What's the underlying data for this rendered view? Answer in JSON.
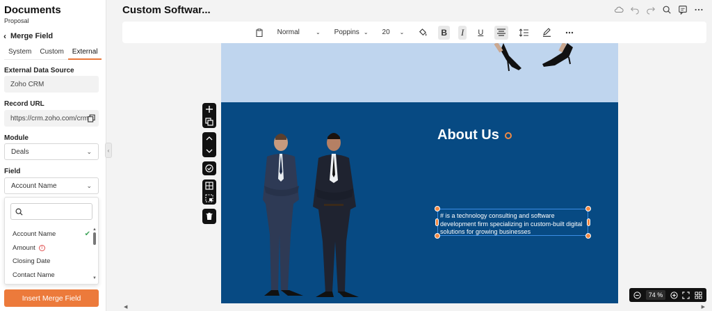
{
  "sidebar": {
    "title": "Documents",
    "subtitle": "Proposal",
    "back_label": "Merge Field",
    "tabs": [
      {
        "label": "System"
      },
      {
        "label": "Custom"
      },
      {
        "label": "External"
      }
    ],
    "external_source": {
      "label": "External Data Source",
      "value": "Zoho CRM"
    },
    "record_url": {
      "label": "Record URL",
      "value": "https://crm.zoho.com/crm/"
    },
    "module": {
      "label": "Module",
      "value": "Deals"
    },
    "field": {
      "label": "Field",
      "value": "Account Name"
    },
    "dropdown": {
      "search_placeholder": "",
      "items": [
        {
          "label": "Account Name",
          "selected": true
        },
        {
          "label": "Amount",
          "warning": true
        },
        {
          "label": "Closing Date"
        },
        {
          "label": "Contact Name"
        }
      ]
    },
    "insert_button": "Insert Merge Field"
  },
  "header": {
    "doc_title": "Custom Softwar..."
  },
  "toolbar": {
    "style": "Normal",
    "font": "Poppins",
    "size": "20"
  },
  "canvas": {
    "about_title": "About Us",
    "description": "# is a technology consulting and software development firm specializing in custom-built digital solutions for growing businesses",
    "colors": {
      "top": "#bfd5ee",
      "bottom": "#074a83",
      "accent": "#ec7a3b",
      "selection": "#3b8ee6"
    }
  },
  "zoom": {
    "value": "74",
    "unit": "%"
  }
}
